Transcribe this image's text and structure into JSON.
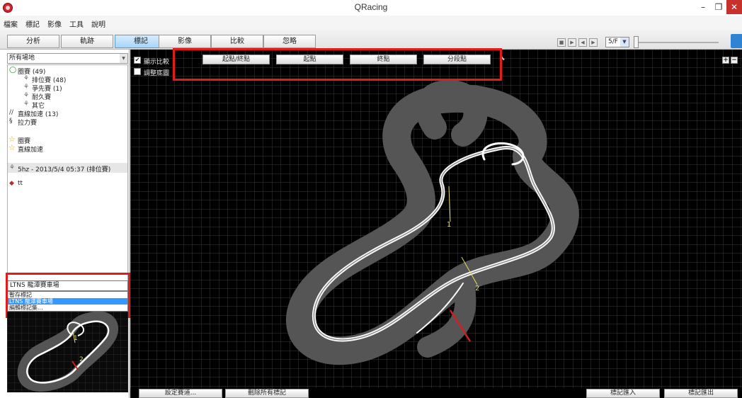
{
  "window": {
    "title": "QRacing",
    "minimize": "–",
    "maximize": "❐",
    "close": "✕"
  },
  "menu": [
    "檔案",
    "標記",
    "影像",
    "工具",
    "說明"
  ],
  "tabs": [
    {
      "label": "分析",
      "active": false
    },
    {
      "label": "軌跡",
      "active": false
    },
    {
      "label": "標記",
      "active": true
    },
    {
      "label": "影像",
      "active": false
    },
    {
      "label": "比較",
      "active": false
    },
    {
      "label": "忽略",
      "active": false
    }
  ],
  "playback": {
    "speed": "5/F",
    "buttons": [
      "stop-icon",
      "play-icon",
      "skip-back-icon",
      "skip-forward-icon"
    ]
  },
  "left_panel": {
    "venue_select": "所有場地",
    "tree": {
      "circuit": "圈賽 (49)",
      "ranking": "排位賽 (48)",
      "leading": "爭先賽 (1)",
      "endurance": "耐久賽",
      "other": "其它",
      "drag": "直線加速 (13)",
      "rally": "拉力賽",
      "fav_circuit": "圈賽",
      "fav_drag": "直線加速",
      "session": "5hz - 2013/5/4 05:37 (排位賽)",
      "tt": "tt"
    },
    "mark_select": "LTNS 龍潭賽車場",
    "mark_options": [
      "暫存標記",
      "LTNS 龍潭賽車場",
      "編輯標記集..."
    ]
  },
  "map_toolbar": {
    "show_compare": "顯示比較",
    "adjust_map": "調整底圖",
    "btn_start_finish": "起點/終點",
    "btn_start": "起點",
    "btn_finish": "終點",
    "btn_split": "分段點"
  },
  "map": {
    "split_1": "1",
    "split_2": "2"
  },
  "minimap": {
    "split_1": "1",
    "split_2": "2"
  },
  "bottom": {
    "set_track": "設定賽道...",
    "delete_all": "刪除所有標記",
    "import": "標記匯入",
    "export": "標記匯出"
  },
  "colors": {
    "highlight": "#e21b1b",
    "selection": "#3399ff",
    "track_gray": "#555555",
    "racing_line": "#ffffff",
    "split_line": "#e8e060"
  }
}
